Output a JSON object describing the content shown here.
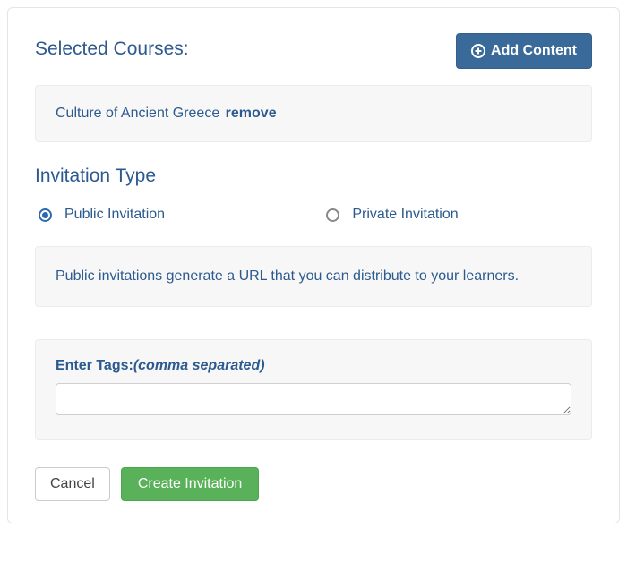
{
  "header": {
    "selected_courses_label": "Selected Courses:",
    "add_content_label": "Add Content"
  },
  "courses": [
    {
      "name": "Culture of Ancient Greece",
      "remove_label": "remove"
    }
  ],
  "invitation": {
    "type_heading": "Invitation Type",
    "options": {
      "public_label": "Public Invitation",
      "private_label": "Private Invitation"
    },
    "selected": "public",
    "public_description": "Public invitations generate a URL that you can distribute to your learners."
  },
  "tags": {
    "label": "Enter Tags:",
    "hint": "(comma separated)",
    "value": ""
  },
  "actions": {
    "cancel_label": "Cancel",
    "create_label": "Create Invitation"
  }
}
